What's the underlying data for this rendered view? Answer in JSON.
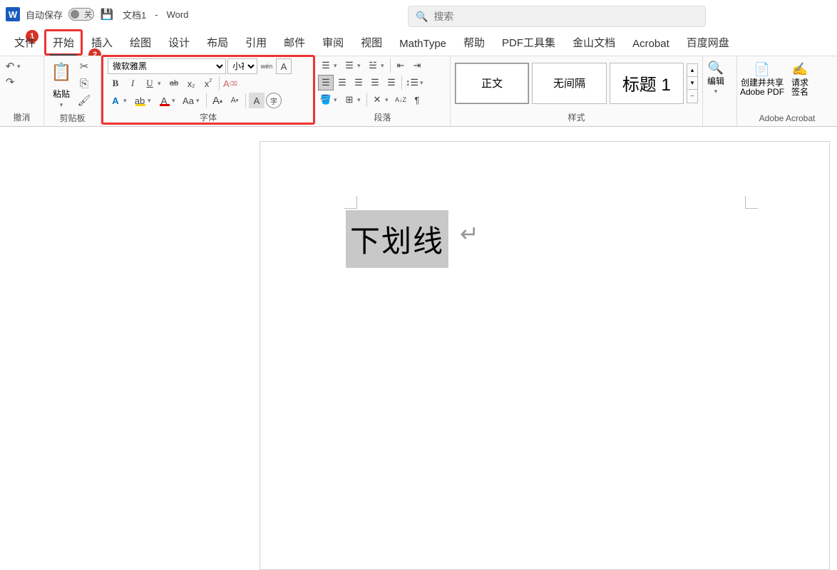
{
  "titlebar": {
    "autosave": "自动保存",
    "toggle_off": "关",
    "doc_name": "文档1",
    "sep": "-",
    "app": "Word"
  },
  "search": {
    "placeholder": "搜索"
  },
  "tabs": {
    "file": "文件",
    "home": "开始",
    "insert": "插入",
    "draw": "绘图",
    "design": "设计",
    "layout": "布局",
    "references": "引用",
    "mailings": "邮件",
    "review": "审阅",
    "view": "视图",
    "mathtype": "MathType",
    "help": "帮助",
    "pdf": "PDF工具集",
    "kingsoft": "金山文档",
    "acrobat": "Acrobat",
    "baidu": "百度网盘"
  },
  "badges": {
    "b1": "1",
    "b2": "2"
  },
  "ribbon": {
    "undo": {
      "label": "撤消"
    },
    "clipboard": {
      "paste": "粘贴",
      "label": "剪贴板"
    },
    "font": {
      "name": "微软雅黑",
      "size": "小初",
      "pinyin": "wén",
      "charborder": "A",
      "bold": "B",
      "italic": "I",
      "underline": "U",
      "strike": "ab",
      "sub_x": "x",
      "sup_x": "x",
      "clear": "A",
      "texteffect": "A",
      "highlight": "ab",
      "fontcolor": "A",
      "changecase": "Aa",
      "grow": "A",
      "shrink": "A",
      "charshade": "A",
      "enclose": "字",
      "label": "字体"
    },
    "paragraph": {
      "sort": "A↓Z",
      "showmarks": "¶",
      "label": "段落"
    },
    "styles": {
      "normal": "正文",
      "nospace": "无间隔",
      "heading1": "标题 1",
      "label": "样式"
    },
    "editing": {
      "label": "编辑"
    },
    "acrobat": {
      "createshare": "创建并共享\nAdobe PDF",
      "sign": "请求\n签名",
      "label": "Adobe Acrobat"
    }
  },
  "document": {
    "selected_text": "下划线",
    "para_mark": "↵"
  }
}
